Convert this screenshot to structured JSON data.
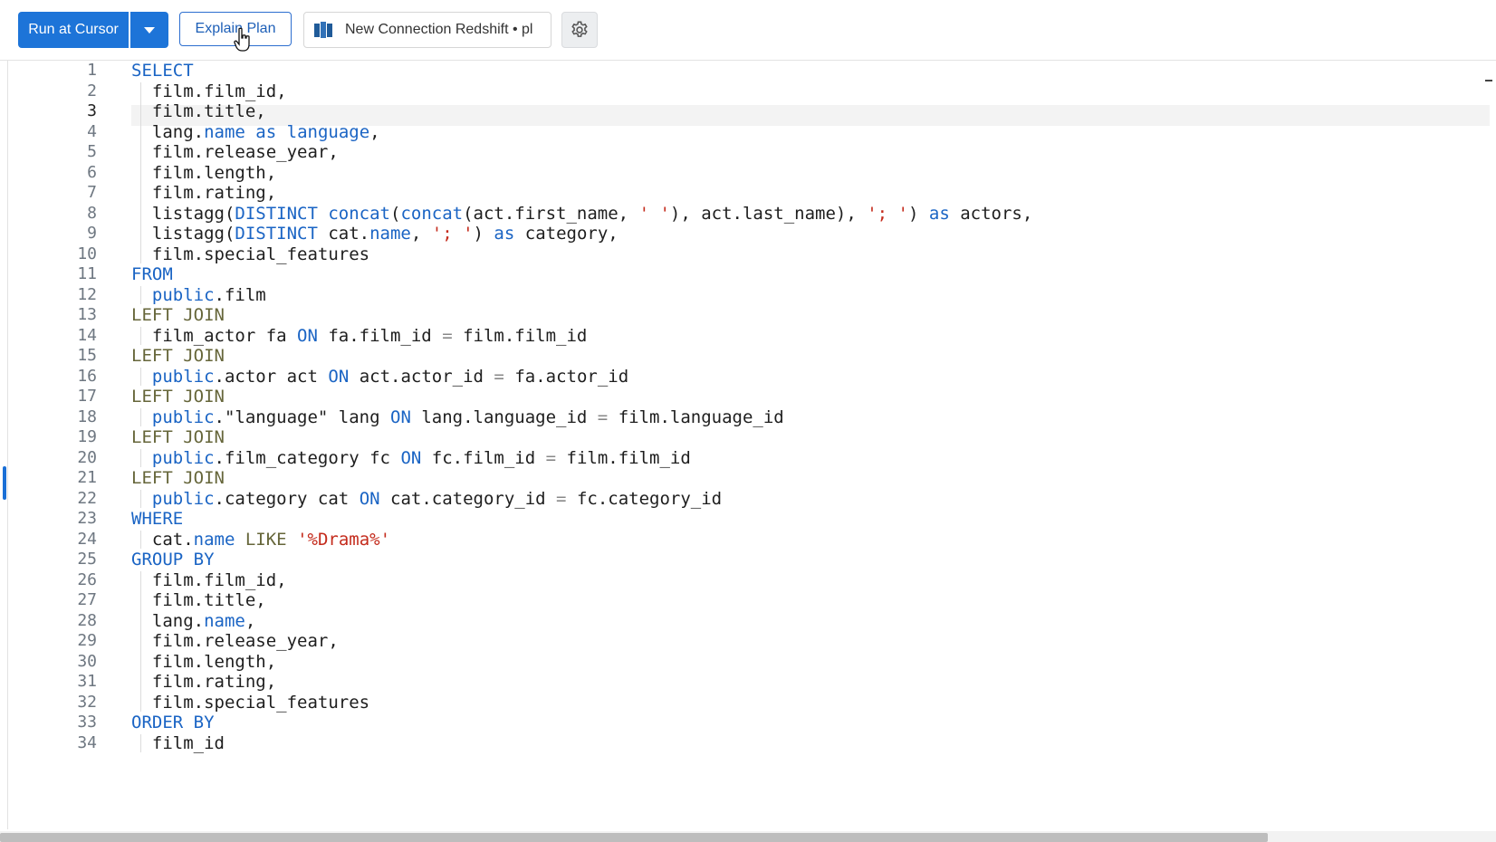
{
  "toolbar": {
    "run_label": "Run at Cursor",
    "explain_label": "Explain Plan",
    "connection_label": "New Connection Redshift • pl"
  },
  "colors": {
    "accent": "#1d74d8",
    "keyword": "#1a64c4",
    "string": "#c42b1c"
  },
  "icons": {
    "run_dropdown": "chevron-down-icon",
    "connection": "redshift-icon",
    "settings": "gear-icon",
    "cursor": "hand-pointer-icon"
  },
  "editor": {
    "active_line": 3,
    "lines": [
      {
        "n": "1",
        "t": [
          [
            "kw",
            "SELECT"
          ]
        ]
      },
      {
        "n": "2",
        "t": [
          [
            "",
            "  film.film_id,"
          ]
        ]
      },
      {
        "n": "3",
        "t": [
          [
            "",
            "  film.title,"
          ]
        ]
      },
      {
        "n": "4",
        "t": [
          [
            "",
            "  lang."
          ],
          [
            "kw",
            "name"
          ],
          [
            "",
            " "
          ],
          [
            "kw",
            "as"
          ],
          [
            "",
            " "
          ],
          [
            "kw",
            "language"
          ],
          [
            "",
            ","
          ]
        ]
      },
      {
        "n": "5",
        "t": [
          [
            "",
            "  film.release_year,"
          ]
        ]
      },
      {
        "n": "6",
        "t": [
          [
            "",
            "  film.length,"
          ]
        ]
      },
      {
        "n": "7",
        "t": [
          [
            "",
            "  film.rating,"
          ]
        ]
      },
      {
        "n": "8",
        "t": [
          [
            "",
            "  listagg("
          ],
          [
            "kw",
            "DISTINCT"
          ],
          [
            "",
            " "
          ],
          [
            "fn",
            "concat"
          ],
          [
            "",
            "("
          ],
          [
            "fn",
            "concat"
          ],
          [
            "",
            "(act.first_name, "
          ],
          [
            "str",
            "' '"
          ],
          [
            "",
            "), act.last_name), "
          ],
          [
            "str",
            "'; '"
          ],
          [
            "",
            ") "
          ],
          [
            "kw",
            "as"
          ],
          [
            "",
            " actors,"
          ]
        ]
      },
      {
        "n": "9",
        "t": [
          [
            "",
            "  listagg("
          ],
          [
            "kw",
            "DISTINCT"
          ],
          [
            "",
            " cat."
          ],
          [
            "kw",
            "name"
          ],
          [
            "",
            ", "
          ],
          [
            "str",
            "'; '"
          ],
          [
            "",
            ") "
          ],
          [
            "kw",
            "as"
          ],
          [
            "",
            " category,"
          ]
        ]
      },
      {
        "n": "10",
        "t": [
          [
            "",
            "  film.special_features"
          ]
        ]
      },
      {
        "n": "11",
        "t": [
          [
            "kw",
            "FROM"
          ]
        ]
      },
      {
        "n": "12",
        "t": [
          [
            "",
            "  "
          ],
          [
            "kw",
            "public"
          ],
          [
            "",
            ".film"
          ]
        ]
      },
      {
        "n": "13",
        "t": [
          [
            "kw2",
            "LEFT JOIN"
          ]
        ]
      },
      {
        "n": "14",
        "t": [
          [
            "",
            "  film_actor fa "
          ],
          [
            "kw",
            "ON"
          ],
          [
            "",
            " fa.film_id "
          ],
          [
            "op",
            "="
          ],
          [
            "",
            " film.film_id"
          ]
        ]
      },
      {
        "n": "15",
        "t": [
          [
            "kw2",
            "LEFT JOIN"
          ]
        ]
      },
      {
        "n": "16",
        "t": [
          [
            "",
            "  "
          ],
          [
            "kw",
            "public"
          ],
          [
            "",
            ".actor act "
          ],
          [
            "kw",
            "ON"
          ],
          [
            "",
            " act.actor_id "
          ],
          [
            "op",
            "="
          ],
          [
            "",
            " fa.actor_id"
          ]
        ]
      },
      {
        "n": "17",
        "t": [
          [
            "kw2",
            "LEFT JOIN"
          ]
        ]
      },
      {
        "n": "18",
        "t": [
          [
            "",
            "  "
          ],
          [
            "kw",
            "public"
          ],
          [
            "",
            ".\"language\" lang "
          ],
          [
            "kw",
            "ON"
          ],
          [
            "",
            " lang.language_id "
          ],
          [
            "op",
            "="
          ],
          [
            "",
            " film.language_id"
          ]
        ]
      },
      {
        "n": "19",
        "t": [
          [
            "kw2",
            "LEFT JOIN"
          ]
        ]
      },
      {
        "n": "20",
        "t": [
          [
            "",
            "  "
          ],
          [
            "kw",
            "public"
          ],
          [
            "",
            ".film_category fc "
          ],
          [
            "kw",
            "ON"
          ],
          [
            "",
            " fc.film_id "
          ],
          [
            "op",
            "="
          ],
          [
            "",
            " film.film_id"
          ]
        ]
      },
      {
        "n": "21",
        "t": [
          [
            "kw2",
            "LEFT JOIN"
          ]
        ]
      },
      {
        "n": "22",
        "t": [
          [
            "",
            "  "
          ],
          [
            "kw",
            "public"
          ],
          [
            "",
            ".category cat "
          ],
          [
            "kw",
            "ON"
          ],
          [
            "",
            " cat.category_id "
          ],
          [
            "op",
            "="
          ],
          [
            "",
            " fc.category_id"
          ]
        ]
      },
      {
        "n": "23",
        "t": [
          [
            "kw",
            "WHERE"
          ]
        ]
      },
      {
        "n": "24",
        "t": [
          [
            "",
            "  cat."
          ],
          [
            "kw",
            "name"
          ],
          [
            "",
            " "
          ],
          [
            "kw2",
            "LIKE"
          ],
          [
            "",
            " "
          ],
          [
            "str",
            "'%Drama%'"
          ]
        ]
      },
      {
        "n": "25",
        "t": [
          [
            "kw",
            "GROUP BY"
          ]
        ]
      },
      {
        "n": "26",
        "t": [
          [
            "",
            "  film.film_id,"
          ]
        ]
      },
      {
        "n": "27",
        "t": [
          [
            "",
            "  film.title,"
          ]
        ]
      },
      {
        "n": "28",
        "t": [
          [
            "",
            "  lang."
          ],
          [
            "kw",
            "name"
          ],
          [
            "",
            ","
          ]
        ]
      },
      {
        "n": "29",
        "t": [
          [
            "",
            "  film.release_year,"
          ]
        ]
      },
      {
        "n": "30",
        "t": [
          [
            "",
            "  film.length,"
          ]
        ]
      },
      {
        "n": "31",
        "t": [
          [
            "",
            "  film.rating,"
          ]
        ]
      },
      {
        "n": "32",
        "t": [
          [
            "",
            "  film.special_features"
          ]
        ]
      },
      {
        "n": "33",
        "t": [
          [
            "kw",
            "ORDER BY"
          ]
        ]
      },
      {
        "n": "34",
        "t": [
          [
            "",
            "  film_id"
          ]
        ]
      }
    ]
  }
}
